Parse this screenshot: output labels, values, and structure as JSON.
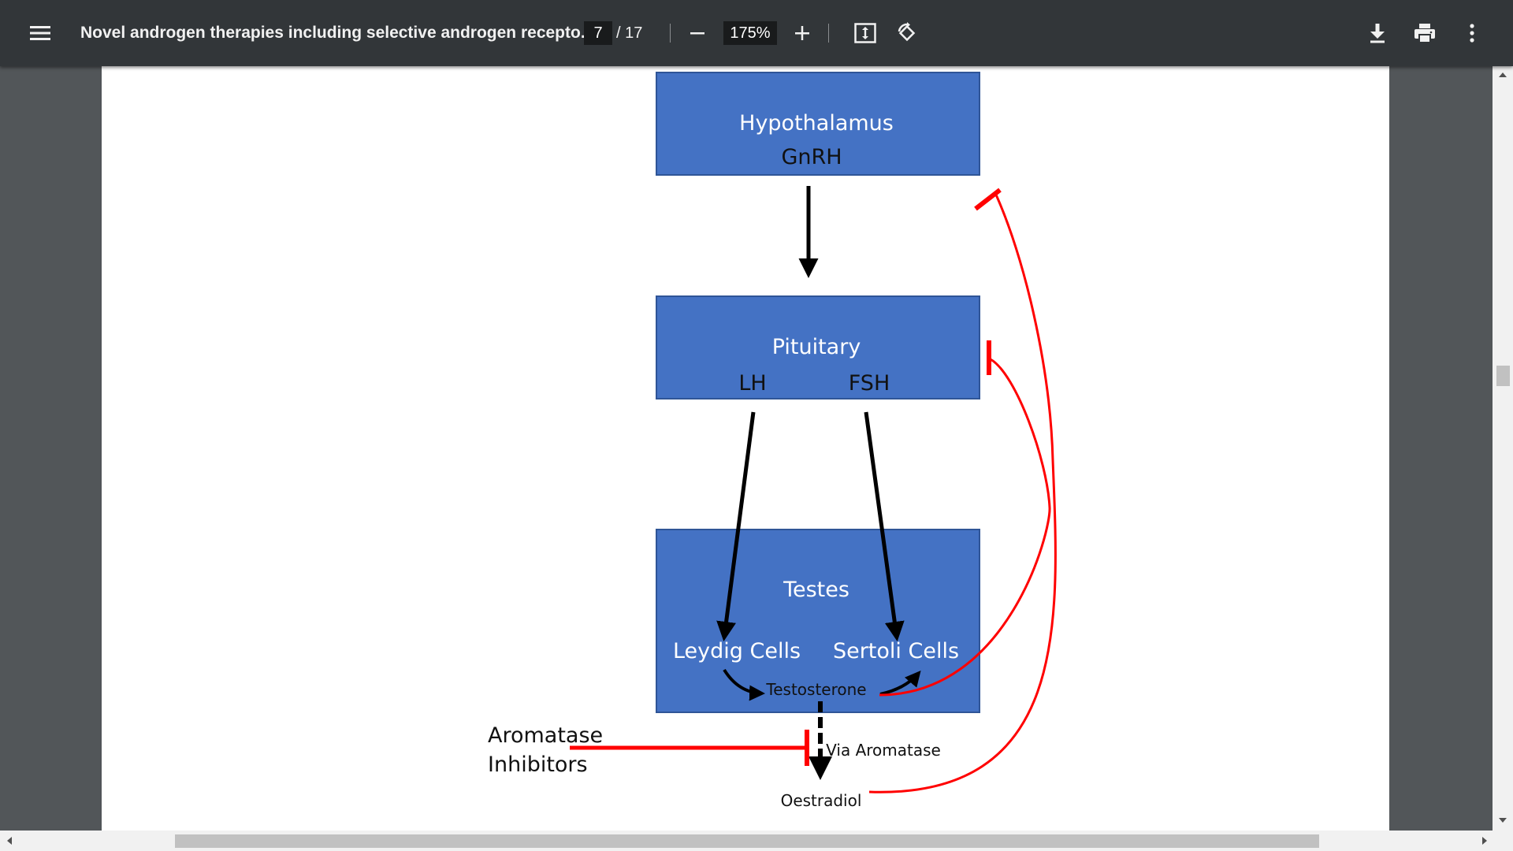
{
  "toolbar": {
    "title": "Novel androgen therapies including selective androgen recepto...",
    "page_current": "7",
    "page_total": "/ 17",
    "zoom": "175%",
    "icons": [
      "menu-icon",
      "zoom-out-icon",
      "zoom-in-icon",
      "fit-page-icon",
      "rotate-icon",
      "download-icon",
      "print-icon",
      "more-vert-icon"
    ]
  },
  "diagram": {
    "hypothalamus": {
      "title": "Hypothalamus",
      "hormone": "GnRH"
    },
    "pituitary": {
      "title": "Pituitary",
      "hormone_left": "LH",
      "hormone_right": "FSH"
    },
    "testes": {
      "title": "Testes",
      "left_cells": "Leydig Cells",
      "right_cells": "Sertoli Cells",
      "product": "Testosterone"
    },
    "aromatase_label": "Via Aromatase",
    "oestradiol": "Oestradiol",
    "inhibitors_line1": "Aromatase",
    "inhibitors_line2": "Inhibitors",
    "colors": {
      "box": "#4472c4",
      "inhibition": "#ff0000",
      "arrow": "#000000"
    }
  }
}
